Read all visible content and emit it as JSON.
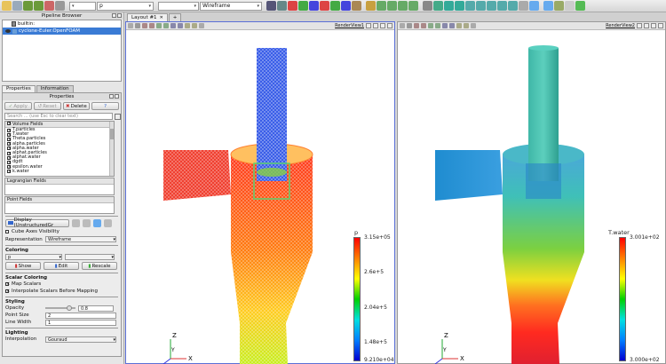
{
  "toolbar": {
    "active_variable": "p",
    "representation": "Wireframe",
    "components_combo": ""
  },
  "pipeline_browser": {
    "title": "Pipeline Browser",
    "items": [
      {
        "label": "builtin:"
      },
      {
        "label": "cyclone-Euler.OpenFOAM"
      }
    ]
  },
  "tabs": [
    "Properties",
    "Information"
  ],
  "properties": {
    "title": "Properties",
    "apply": "Apply",
    "reset": "Reset",
    "delete": "Delete",
    "help": "?",
    "search_placeholder": "Search ... (use Esc to clear text)",
    "volume_fields_header": "Volume Fields",
    "volume_fields": [
      "T.particles",
      "T.water",
      "Theta.particles",
      "alpha.particles",
      "alpha.water",
      "alphat.particles",
      "alphat.water",
      "dgdt",
      "epsilon.water",
      "k.water"
    ],
    "lagrangian_header": "Lagrangian Fields",
    "point_fields_header": "Point Fields",
    "display_label": "Display (UnstructuredGr",
    "cube_axes": "Cube Axes Visibility",
    "representation_label": "Representation",
    "representation_value": "Wireframe",
    "coloring_header": "Coloring",
    "coloring_value": "p",
    "show": "Show",
    "edit": "Edit",
    "rescale": "Rescale",
    "scalar_coloring_header": "Scalar Coloring",
    "map_scalars": "Map Scalars",
    "interpolate_scalars": "Interpolate Scalars Before Mapping",
    "styling_header": "Styling",
    "opacity_label": "Opacity",
    "opacity_value": "0.8",
    "opacity_level": 0.8,
    "point_size_label": "Point Size",
    "point_size_value": "2",
    "line_width_label": "Line Width",
    "line_width_value": "1",
    "lighting_header": "Lighting",
    "interpolation_label": "Interpolation",
    "interpolation_value": "Gouraud"
  },
  "layout": {
    "tab_label": "Layout #1",
    "plus": "+"
  },
  "views": {
    "left": {
      "title": "RenderView1",
      "legend_title": "p",
      "ticks": [
        "3.15e+05",
        "2.6e+5",
        "2.04e+5",
        "1.48e+5",
        "9.210e+04"
      ]
    },
    "right": {
      "title": "RenderView2",
      "legend_title": "T.water",
      "ticks": [
        "3.001e+02",
        "3.000e+02"
      ]
    }
  },
  "colors": {
    "selection": "#3a7bd5",
    "wire_blue": "#2a4fe0",
    "wire_red": "#e83030",
    "cyan_solid": "#3fb7a7"
  }
}
